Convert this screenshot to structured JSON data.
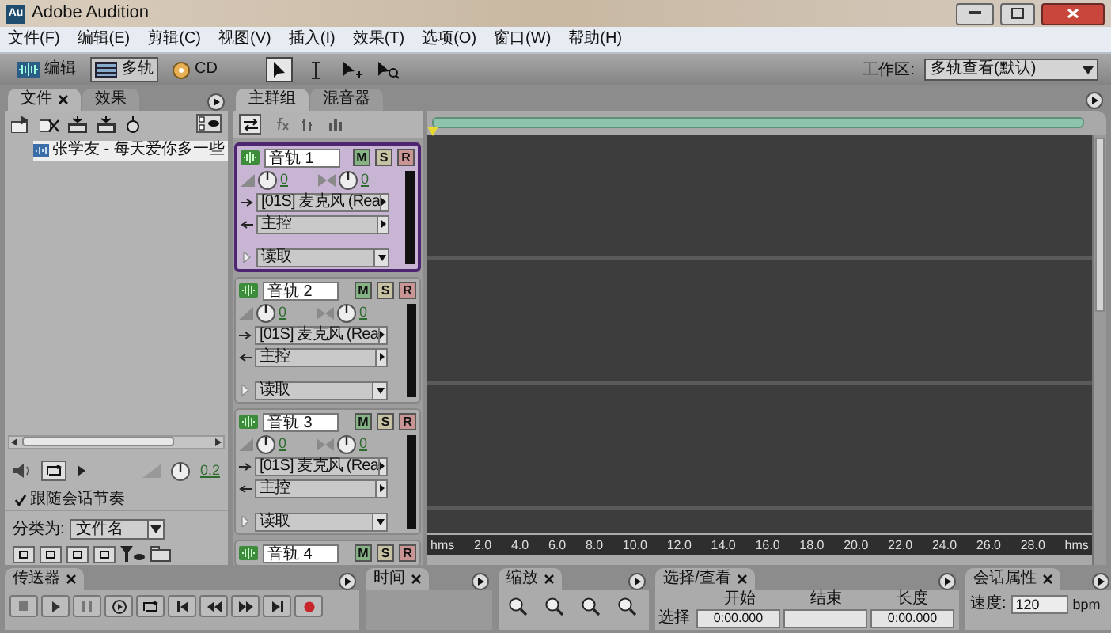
{
  "window": {
    "app_icon": "Au",
    "title": "Adobe Audition"
  },
  "menu": [
    "文件(F)",
    "编辑(E)",
    "剪辑(C)",
    "视图(V)",
    "插入(I)",
    "效果(T)",
    "选项(O)",
    "窗口(W)",
    "帮助(H)"
  ],
  "toolbar": {
    "views": [
      {
        "kind": "edit",
        "label": "编辑",
        "selected": false
      },
      {
        "kind": "multitrack",
        "label": "多轨",
        "selected": true
      },
      {
        "kind": "cd",
        "label": "CD",
        "selected": false
      }
    ],
    "tools": [
      {
        "kind": "move",
        "selected": true
      },
      {
        "kind": "time",
        "selected": false
      },
      {
        "kind": "hybrid",
        "selected": false
      },
      {
        "kind": "scrub",
        "selected": false
      }
    ],
    "workspace_label": "工作区:",
    "workspace_value": "多轨查看(默认)"
  },
  "files_panel": {
    "tabs": [
      {
        "label": "文件",
        "closable": true,
        "selected": true
      },
      {
        "label": "效果",
        "closable": false,
        "selected": false
      }
    ],
    "files": [
      {
        "name": "张学友 - 每天爱你多一些",
        "selected": true
      }
    ],
    "volume_reading": "0.2",
    "follow_tempo": {
      "label": "跟随会话节奏",
      "checked": true
    },
    "sort_label": "分类为:",
    "sort_value": "文件名"
  },
  "tracks_panel": {
    "tabs": [
      {
        "label": "主群组",
        "closable": false,
        "selected": true
      },
      {
        "label": "混音器",
        "closable": false,
        "selected": false
      }
    ],
    "tracks": [
      {
        "name": "音轨 1",
        "selected": true,
        "buttons": [
          "M",
          "S",
          "R"
        ],
        "volume": "0",
        "pan": "0",
        "input": "[01S] 麦克风 (Rea",
        "output": "主控",
        "automation": "读取"
      },
      {
        "name": "音轨 2",
        "selected": false,
        "buttons": [
          "M",
          "S",
          "R"
        ],
        "volume": "0",
        "pan": "0",
        "input": "[01S] 麦克风 (Rea",
        "output": "主控",
        "automation": "读取"
      },
      {
        "name": "音轨 3",
        "selected": false,
        "buttons": [
          "M",
          "S",
          "R"
        ],
        "volume": "0",
        "pan": "0",
        "input": "[01S] 麦克风 (Rea",
        "output": "主控",
        "automation": "读取"
      },
      {
        "name": "音轨 4",
        "selected": false,
        "buttons": [
          "M",
          "S",
          "R"
        ]
      }
    ]
  },
  "timeline": {
    "ruler": [
      "hms",
      "2.0",
      "4.0",
      "6.0",
      "8.0",
      "10.0",
      "12.0",
      "14.0",
      "16.0",
      "18.0",
      "20.0",
      "22.0",
      "24.0",
      "26.0",
      "28.0",
      "hms"
    ]
  },
  "bottom_panels": [
    {
      "kind": "transport",
      "title": "传送器",
      "closable": true
    },
    {
      "kind": "time",
      "title": "时间",
      "closable": true
    },
    {
      "kind": "zoom",
      "title": "缩放",
      "closable": true
    },
    {
      "kind": "selection",
      "title": "选择/查看",
      "closable": true,
      "columns": [
        "开始",
        "结束",
        "长度"
      ],
      "row_label": "选择",
      "start": "0:00.000",
      "length": "0:00.000"
    },
    {
      "kind": "session",
      "title": "会话属性",
      "closable": true,
      "label": "速度:",
      "value": "120",
      "unit": "bpm"
    }
  ]
}
